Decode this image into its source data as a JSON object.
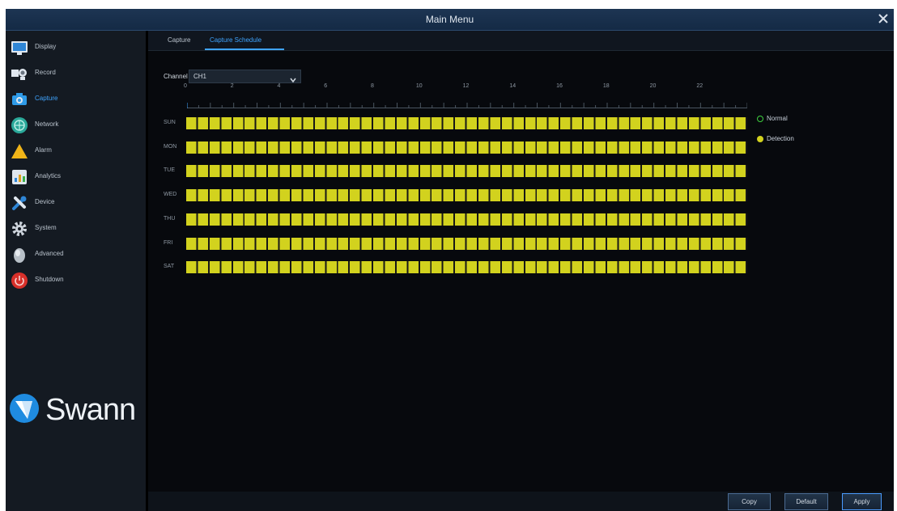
{
  "window": {
    "title": "Main Menu"
  },
  "sidebar": {
    "items": [
      {
        "label": "Display",
        "icon": "display-icon"
      },
      {
        "label": "Record",
        "icon": "record-icon"
      },
      {
        "label": "Capture",
        "icon": "capture-icon",
        "active": true
      },
      {
        "label": "Network",
        "icon": "network-icon"
      },
      {
        "label": "Alarm",
        "icon": "alarm-icon"
      },
      {
        "label": "Analytics",
        "icon": "analytics-icon"
      },
      {
        "label": "Device",
        "icon": "device-icon"
      },
      {
        "label": "System",
        "icon": "system-icon"
      },
      {
        "label": "Advanced",
        "icon": "advanced-icon"
      },
      {
        "label": "Shutdown",
        "icon": "shutdown-icon"
      }
    ],
    "logo_text": "Swann"
  },
  "tabs": [
    {
      "label": "Capture",
      "active": false
    },
    {
      "label": "Capture Schedule",
      "active": true
    }
  ],
  "schedule": {
    "channel_label": "Channel",
    "channel_value": "CH1",
    "hours": [
      "0",
      "2",
      "4",
      "6",
      "8",
      "10",
      "12",
      "14",
      "16",
      "18",
      "20",
      "22"
    ],
    "days": [
      "SUN",
      "MON",
      "TUE",
      "WED",
      "THU",
      "FRI",
      "SAT"
    ]
  },
  "legend": [
    {
      "label": "Normal",
      "color": "#3ecf3e"
    },
    {
      "label": "Detection",
      "color": "#d2d21e"
    }
  ],
  "buttons": {
    "copy": "Copy",
    "default": "Default",
    "apply": "Apply"
  },
  "colors": {
    "accent": "#3fa4ff",
    "schedule_fill": "#d2d21e",
    "title_bar": "#1a3150"
  }
}
